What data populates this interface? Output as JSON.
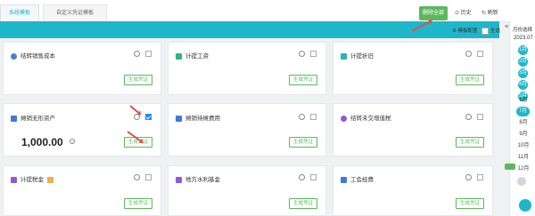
{
  "tabs": {
    "system": "系统模板",
    "custom": "自定义凭证模板"
  },
  "toolbar": {
    "delete_all": "删除全部",
    "history": "历史",
    "refresh": "刷新"
  },
  "header": {
    "template_config": "模板配置",
    "select_all": "全选"
  },
  "cards": [
    {
      "title": "结转销售成本",
      "button": "生成凭证",
      "checked": false
    },
    {
      "title": "计提工资",
      "button": "生成凭证",
      "checked": false
    },
    {
      "title": "计提折旧",
      "button": "生成凭证",
      "checked": false
    },
    {
      "title": "摊销无形资产",
      "button": "生成凭证",
      "checked": true,
      "amount": "1,000.00"
    },
    {
      "title": "摊销待摊费用",
      "button": "生成凭证",
      "checked": false
    },
    {
      "title": "结转未交增值税",
      "button": "生成凭证",
      "checked": false
    },
    {
      "title": "计提税金",
      "button": "生成凭证",
      "checked": false
    },
    {
      "title": "地方水利基金",
      "button": "生成凭证",
      "checked": false
    },
    {
      "title": "工会经费",
      "button": "生成凭证",
      "checked": false
    }
  ],
  "sidebar": {
    "title": "月份选择",
    "year": "2023.07",
    "months": [
      "1月",
      "2月",
      "3月",
      "4月",
      "5月",
      "6月",
      "7月",
      "8月",
      "9月",
      "10月",
      "11月",
      "12月"
    ],
    "selected_month": "7月"
  },
  "colors": {
    "accent": "#1fb6c9",
    "green": "#5cb85c",
    "red_annotation": "#d9534f",
    "checkbox_blue": "#1a8cff"
  }
}
